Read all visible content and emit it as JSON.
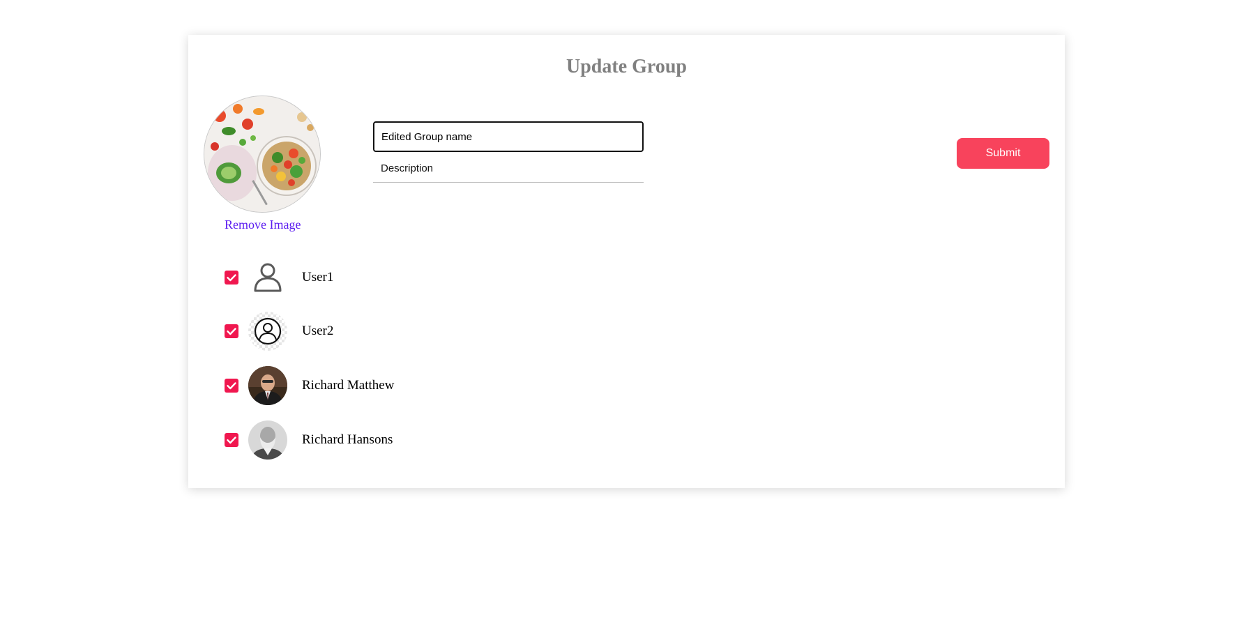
{
  "form": {
    "title": "Update Group",
    "remove_image_label": "Remove Image",
    "group_name_value": "Edited Group name",
    "description_placeholder": "Description",
    "description_value": "",
    "submit_label": "Submit"
  },
  "members": [
    {
      "name": "User1",
      "checked": true,
      "avatar": "person-outline-icon"
    },
    {
      "name": "User2",
      "checked": true,
      "avatar": "person-circle-icon"
    },
    {
      "name": "Richard Matthew",
      "checked": true,
      "avatar": "photo"
    },
    {
      "name": "Richard Hansons",
      "checked": true,
      "avatar": "photo"
    }
  ],
  "colors": {
    "accent": "#f8435c",
    "checkbox": "#f0174f",
    "link": "#5b1cf0",
    "title": "#808080"
  }
}
